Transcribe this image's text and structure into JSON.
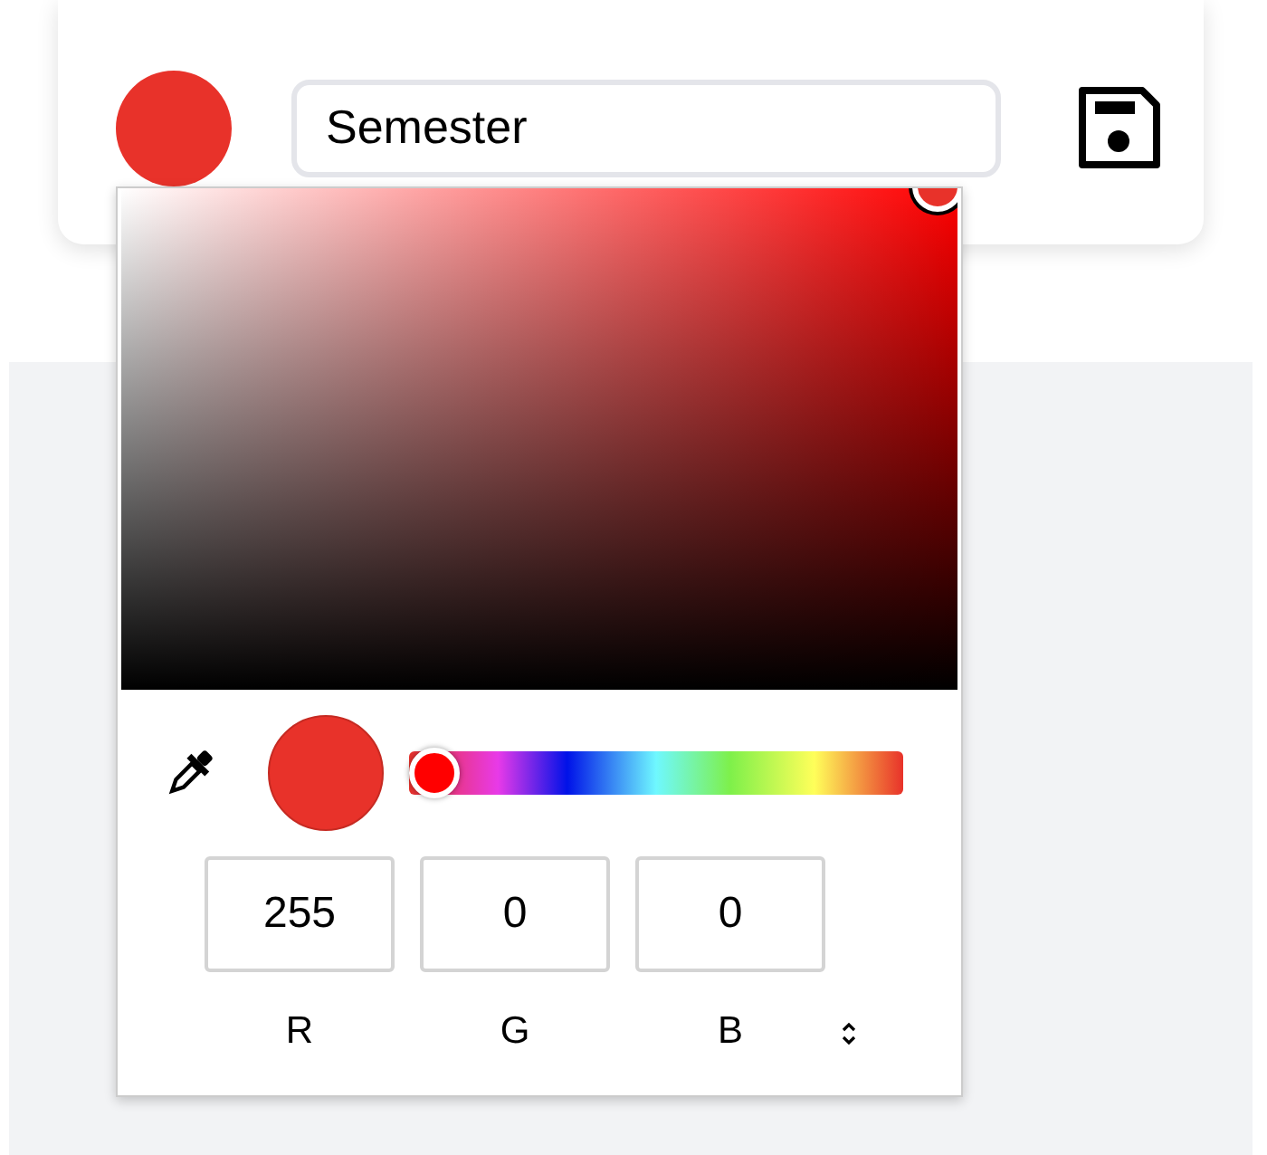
{
  "header": {
    "color": "#e8322a",
    "title_value": "Semester"
  },
  "picker": {
    "hue_slider": {
      "level": 0
    },
    "channels": [
      {
        "label": "R",
        "value": "255"
      },
      {
        "label": "G",
        "value": "0"
      },
      {
        "label": "B",
        "value": "0"
      }
    ]
  }
}
